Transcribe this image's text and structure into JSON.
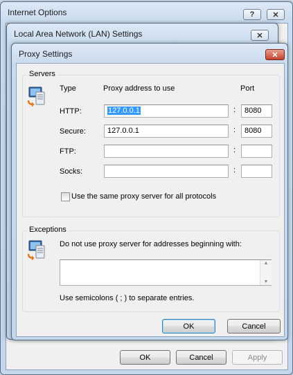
{
  "internet_options": {
    "title": "Internet Options",
    "help_glyph": "?",
    "close_glyph": "✕",
    "buttons": {
      "ok": "OK",
      "cancel": "Cancel",
      "apply": "Apply"
    }
  },
  "lan_settings": {
    "title": "Local Area Network (LAN) Settings",
    "close_glyph": "✕"
  },
  "proxy_settings": {
    "title": "Proxy Settings",
    "close_glyph": "✕",
    "servers": {
      "group_label": "Servers",
      "col_type": "Type",
      "col_address": "Proxy address to use",
      "col_port": "Port",
      "colon": ":",
      "rows": [
        {
          "type": "HTTP:",
          "address": "127.0.0.1",
          "port": "8080",
          "selected": true
        },
        {
          "type": "Secure:",
          "address": "127.0.0.1",
          "port": "8080"
        },
        {
          "type": "FTP:",
          "address": "",
          "port": ""
        },
        {
          "type": "Socks:",
          "address": "",
          "port": ""
        }
      ],
      "same_proxy_label": "Use the same proxy server for all protocols",
      "same_proxy_checked": false
    },
    "exceptions": {
      "group_label": "Exceptions",
      "description": "Do not use proxy server for addresses beginning with:",
      "value": "",
      "hint": "Use semicolons ( ; ) to separate entries."
    },
    "buttons": {
      "ok": "OK",
      "cancel": "Cancel"
    }
  },
  "icon_names": [
    "computer-network-icon"
  ]
}
